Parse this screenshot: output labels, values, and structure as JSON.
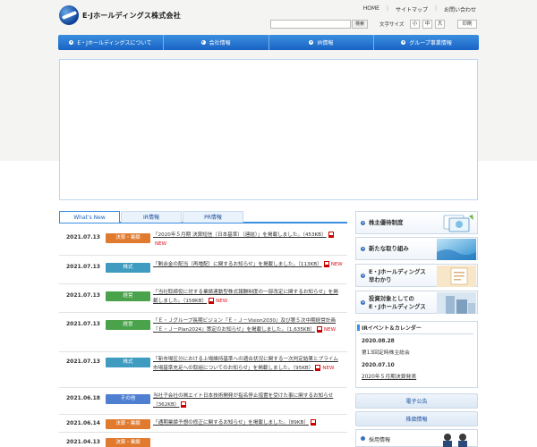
{
  "header": {
    "logo_text": "E·Jホールディングス株式会社",
    "util_links": [
      "HOME",
      "サイトマップ",
      "お問い合わせ"
    ],
    "search_button": "検索",
    "fontsize_label": "文字サイズ",
    "fontsize_options": [
      "小",
      "中",
      "大"
    ],
    "print_label": "印刷"
  },
  "nav": [
    "E・Jホールディングスについて",
    "会社情報",
    "IR情報",
    "グループ事業情報"
  ],
  "tabs": [
    "What's New",
    "IR情報",
    "PR情報"
  ],
  "news": [
    {
      "date": "2021.07.13",
      "tag": "決算・業績",
      "text": "「2020年５月期 決算短信〔日本基準〕（連結）」を掲載しました。（453KB）",
      "new": "NEW"
    },
    {
      "date": "2021.07.13",
      "tag": "株式",
      "text": "「剰余金の配当（再増配）に関するお知らせ」を掲載しました。（113KB）",
      "new": "NEW"
    },
    {
      "date": "2021.07.13",
      "tag": "経営",
      "text": "「当社取締役に対する業績連動型株式報酬制度の一部改定に関するお知らせ」を掲載しました。（158KB）",
      "new": "NEW"
    },
    {
      "date": "2021.07.13",
      "tag": "経営",
      "text": "「Ｅ・Ｊグループ長期ビジョン『Ｅ・Ｊ－Vision2030』及び第５次中期経営計画『Ｅ・Ｊ－Plan2024』策定のお知らせ」を掲載しました。（1,635KB）",
      "new": "NEW"
    },
    {
      "date": "2021.07.13",
      "tag": "株式",
      "text": "「新市場区分における上場維持基準への適合状況に関する一次判定結果とプライム市場基準充足への取組についてのお知らせ」を掲載しました。（95KB）",
      "new": "NEW"
    },
    {
      "date": "2021.06.18",
      "tag": "その他",
      "text": "当社子会社の㈱エイト日本技術開発が指名停止措置を受けた事に関するお知らせ（362KB）",
      "new": ""
    },
    {
      "date": "2021.06.14",
      "tag": "決算・業績",
      "text": "「通期業績予想の修正に関するお知らせ」を掲載しました。（89KB）",
      "new": ""
    },
    {
      "date": "2021.04.13",
      "tag": "決算・業績",
      "text": "",
      "new": ""
    }
  ],
  "tag_colors": {
    "決算・業績": "#e07a2f",
    "株式": "#3f9cc0",
    "経営": "#4aa24a",
    "その他": "#4f7fd0"
  },
  "side": {
    "banners": [
      "株主優待制度",
      "新たな取り組み",
      "E・Jホールディングス\n早わかり",
      "投資対象としての\nE・Jホールディングス"
    ],
    "ir_title": "IRイベント＆カレンダー",
    "ir_events": [
      {
        "date": "2020.08.28",
        "text": "第13回定時株主総会"
      },
      {
        "date": "2020.07.10",
        "text": "2020年５月期決算発表"
      }
    ],
    "links": [
      "電子公告",
      "株価情報"
    ],
    "recruit": "採用情報"
  }
}
